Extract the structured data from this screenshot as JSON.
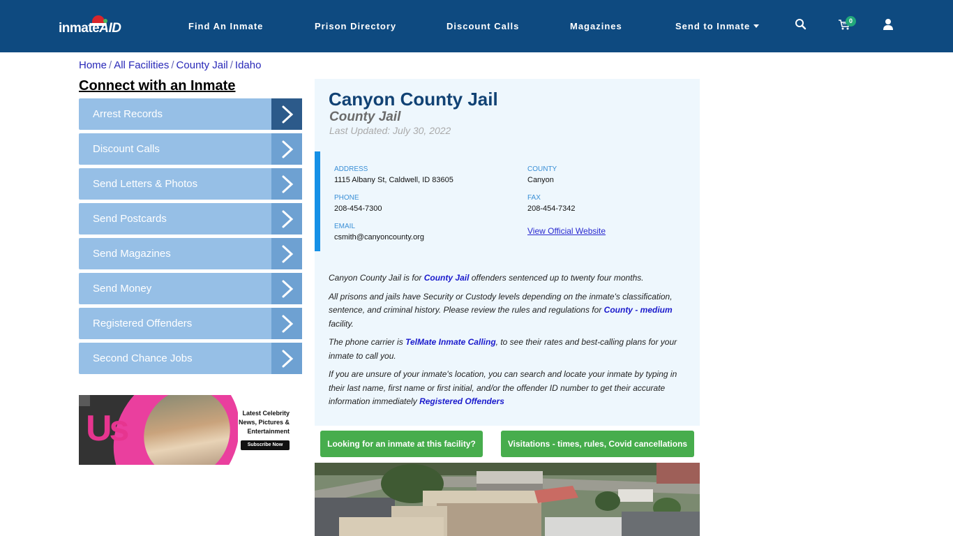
{
  "header": {
    "logo_text": "inmate",
    "logo_text_accent": "AID",
    "nav": [
      {
        "label": "Find An Inmate"
      },
      {
        "label": "Prison Directory"
      },
      {
        "label": "Discount Calls"
      },
      {
        "label": "Magazines"
      },
      {
        "label": "Send to Inmate",
        "has_dropdown": true
      }
    ],
    "icons": {
      "search": "search-icon",
      "cart": "cart-icon",
      "user": "user-icon"
    },
    "cart_count": "0"
  },
  "breadcrumb": [
    {
      "label": "Home"
    },
    {
      "label": "All Facilities"
    },
    {
      "label": "County Jail"
    },
    {
      "label": "Idaho"
    }
  ],
  "breadcrumb_separator": "/",
  "sidebar": {
    "title": "Connect with an Inmate",
    "items": [
      {
        "label": "Arrest Records"
      },
      {
        "label": "Discount Calls"
      },
      {
        "label": "Send Letters & Photos"
      },
      {
        "label": "Send Postcards"
      },
      {
        "label": "Send Magazines"
      },
      {
        "label": "Send Money"
      },
      {
        "label": "Registered Offenders"
      },
      {
        "label": "Second Chance Jobs"
      }
    ],
    "ad": {
      "brand": "Us",
      "headline": "Latest Celebrity News, Pictures & Entertainment",
      "cta": "Subscribe Now"
    }
  },
  "facility": {
    "name": "Canyon County Jail",
    "type": "County Jail",
    "last_updated": "Last Updated: July 30, 2022",
    "address_label": "ADDRESS",
    "address": "1115 Albany St, Caldwell, ID 83605",
    "county_label": "COUNTY",
    "county": "Canyon",
    "phone_label": "PHONE",
    "phone": "208-454-7300",
    "fax_label": "FAX",
    "fax": "208-454-7342",
    "email_label": "EMAIL",
    "email": "csmith@canyoncounty.org",
    "website_link": "View Official Website"
  },
  "description": {
    "p1_a": "Canyon County Jail is for ",
    "p1_link": "County Jail",
    "p1_b": " offenders sentenced up to twenty four months.",
    "p2_a": "All prisons and jails have Security or Custody levels depending on the inmate's classification, sentence, and criminal history. Please review the rules and regulations for ",
    "p2_link": "County - medium",
    "p2_b": " facility.",
    "p3_a": "The phone carrier is ",
    "p3_link": "TelMate Inmate Calling",
    "p3_b": ", to see their rates and best-calling plans for your inmate to call you.",
    "p4_a": "If you are unsure of your inmate's location, you can search and locate your inmate by typing in their last name, first name or first initial, and/or the offender ID number to get their accurate information immediately ",
    "p4_link": "Registered Offenders"
  },
  "buttons": {
    "find_inmate": "Looking for an inmate at this facility?",
    "visitations": "Visitations - times, rules, Covid cancellations"
  },
  "colors": {
    "header_bg": "#0e4a80",
    "sidebar_item": "#96bfe6",
    "title": "#114274",
    "green": "#47ad4d",
    "accent_bar": "#1590e6"
  }
}
